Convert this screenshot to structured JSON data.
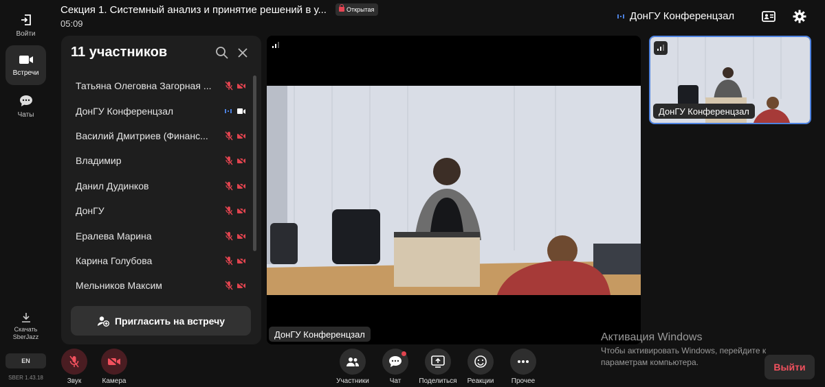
{
  "rail": {
    "login_label": "Войти",
    "meetings_label": "Встречи",
    "chats_label": "Чаты",
    "download_label_1": "Скачать",
    "download_label_2": "SberJazz",
    "language": "EN",
    "version": "SBER 1.43.18"
  },
  "header": {
    "title": "Секция 1. Системный анализ и принятие решений в у...",
    "badge": "Открытая",
    "timer": "05:09",
    "room_name": "ДонГУ Конференцзал",
    "accent_color": "#4d82e0"
  },
  "participants": {
    "title": "11 участников",
    "items": [
      {
        "name": "Татьяна Олеговна Загорная ..."
      },
      {
        "name": "ДонГУ Конференцзал"
      },
      {
        "name": "Василий Дмитриев (Финанс..."
      },
      {
        "name": "Владимир"
      },
      {
        "name": "Данил Дудинков"
      },
      {
        "name": "ДонГУ"
      },
      {
        "name": "Ералева Марина"
      },
      {
        "name": "Карина Голубова"
      },
      {
        "name": "Мельников Максим"
      }
    ],
    "invite_label": "Пригласить на встречу",
    "muted_color": "#e0444f"
  },
  "main_video": {
    "caption": "ДонГУ Конференцзал"
  },
  "thumbnail": {
    "caption": "ДонГУ Конференцзал"
  },
  "windows_activation": {
    "title": "Активация Windows",
    "line1": "Чтобы активировать Windows, перейдите к",
    "line2": "параметрам компьютера."
  },
  "controls": {
    "sound": "Звук",
    "camera": "Камера",
    "participants": "Участники",
    "chat": "Чат",
    "share": "Поделиться",
    "reactions": "Реакции",
    "more": "Прочее",
    "leave": "Выйти"
  }
}
